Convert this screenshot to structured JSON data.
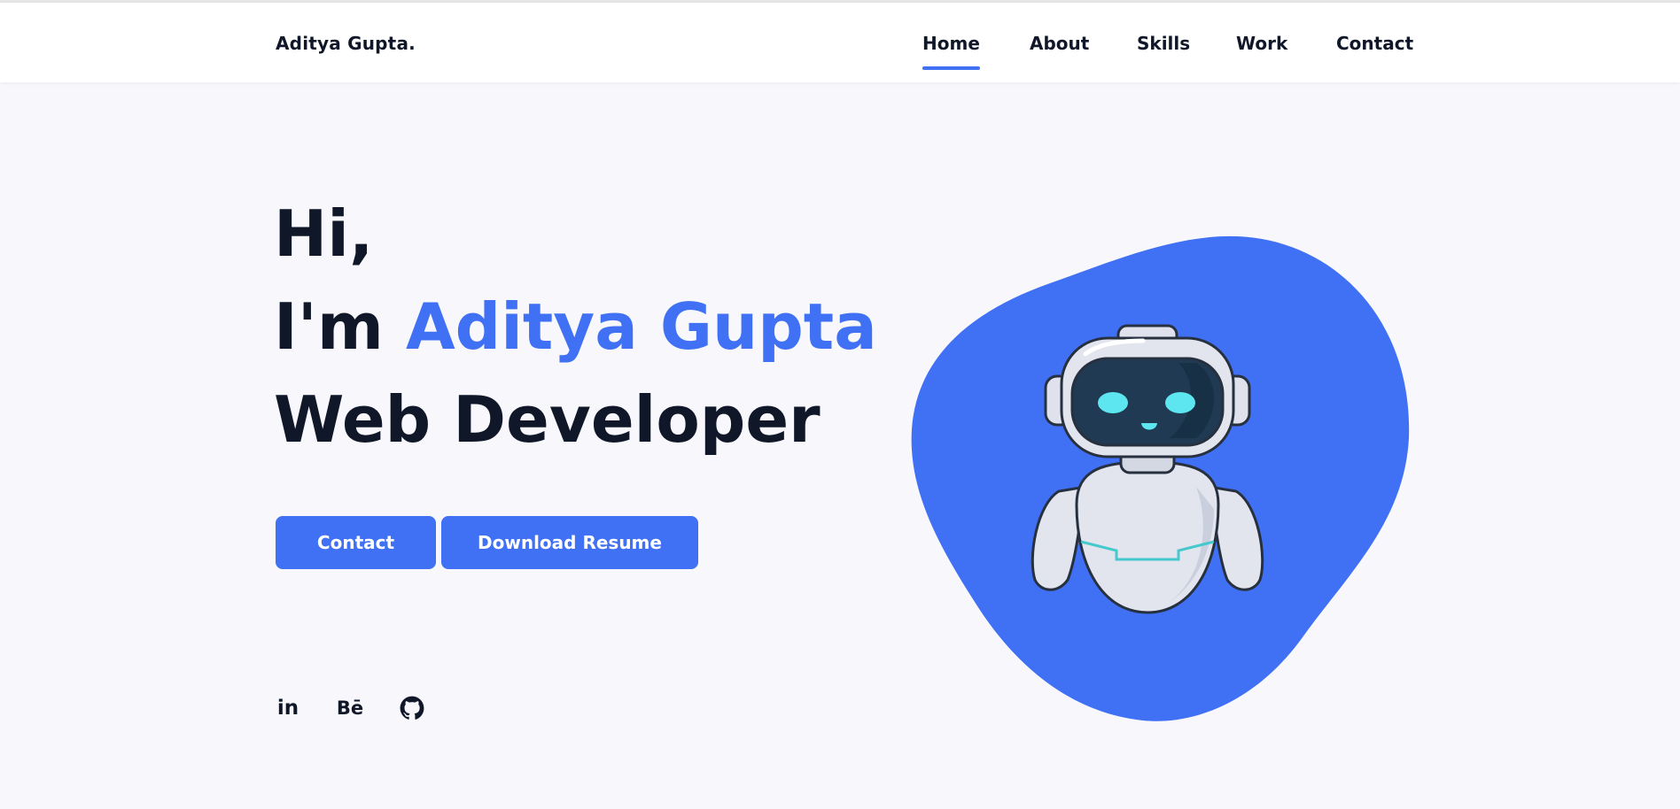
{
  "header": {
    "logo": "Aditya Gupta.",
    "nav": [
      "Home",
      "About",
      "Skills",
      "Work",
      "Contact"
    ],
    "active_nav": "Home"
  },
  "hero": {
    "greeting": "Hi,",
    "intro_prefix": "I'm",
    "name": "Aditya Gupta",
    "role": "Web Developer",
    "buttons": {
      "contact": "Contact",
      "resume": "Download Resume"
    }
  },
  "social": {
    "linkedin": "in",
    "behance": "Bē",
    "github_icon": "github-icon"
  },
  "colors": {
    "accent": "#4070f4",
    "text": "#0f1729",
    "background": "#f8f8fc"
  }
}
